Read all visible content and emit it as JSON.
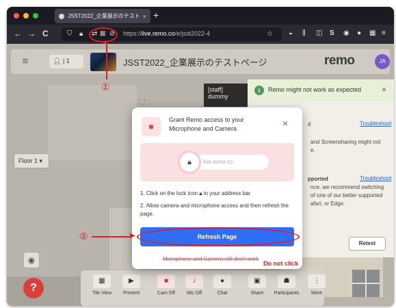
{
  "colors": {
    "accent_blue": "#2f6df5",
    "annotation_red": "#e02020",
    "avatar_purple": "#7a58c9",
    "help_red": "#d8413a",
    "info_green": "#4e9a5b"
  },
  "browser": {
    "tab_title": "JSST2022_企業展示のテストペー",
    "tab_close": "×",
    "new_tab": "+",
    "nav": {
      "back": "←",
      "forward": "→",
      "reload": "C"
    },
    "url_prefix": "https://",
    "url_host": "live.remo.co",
    "url_path": "/e/jsst2022-4",
    "bookmark_icon": "☆"
  },
  "app": {
    "menu_icon": "≡",
    "attendee_count": "1",
    "event_title": "JSST2022_企業展示のテストページ",
    "logo": "remo",
    "avatar_initials": "JA",
    "staff_tile_label": "[staff] dummy",
    "floor_label": "Floor 1"
  },
  "notification": {
    "title": "Remo might not work as expected",
    "close": "×",
    "line1": "d",
    "link1": "Troubleshoot",
    "line2": "and Screensharing might not",
    "line3": "e.",
    "line4": "pported",
    "link2": "Troubleshoot",
    "line5": "nce, we recommend switching",
    "line6": "of one of our better supported",
    "line7": "afari, or Edge.",
    "retest": "Retest"
  },
  "toolbar": {
    "buttons": [
      {
        "label": "Tile View",
        "icon": "grid-icon",
        "glyph": "▦",
        "off": false
      },
      {
        "label": "Present",
        "icon": "present-icon",
        "glyph": "▶",
        "off": false
      },
      {
        "label": "Cam Off",
        "icon": "camera-off-icon",
        "glyph": "■",
        "off": true
      },
      {
        "label": "Mic Off",
        "icon": "mic-off-icon",
        "glyph": "♪",
        "off": true
      },
      {
        "label": "Chat",
        "icon": "chat-icon",
        "glyph": "●",
        "off": false
      },
      {
        "label": "Share",
        "icon": "share-icon",
        "glyph": "▣",
        "off": false
      },
      {
        "label": "Participants",
        "icon": "participants-icon",
        "glyph": "☗",
        "off": false
      },
      {
        "label": "More",
        "icon": "more-icon",
        "glyph": "⋮",
        "off": false
      }
    ]
  },
  "modal": {
    "title": "Grant Remo access to your Microphone and Camera",
    "close": "×",
    "pill_url": "live.remo.co",
    "step1_prefix": "1. Click on the lock icon",
    "step1_suffix": "in your address bar",
    "step2": "2. Allow camera and microphone access and then refresh the page.",
    "refresh_button": "Refresh Page",
    "still_denied": "Microphone and Camera still don't work"
  },
  "annotations": {
    "marker1": "①",
    "marker2": "②",
    "do_not_click": "Do not click"
  }
}
